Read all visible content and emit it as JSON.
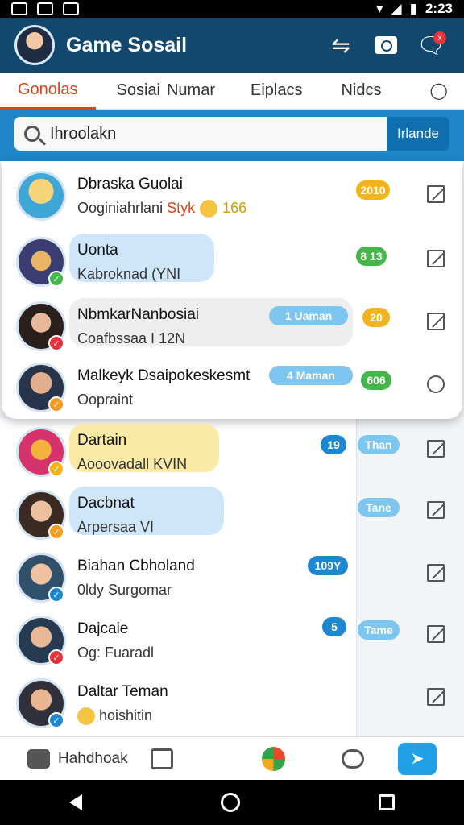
{
  "status": {
    "time": "2:23"
  },
  "app": {
    "title": "Game Sosail"
  },
  "tabs": [
    "Gonolas",
    "Sosiai",
    "Numar",
    "Eiplacs",
    "Nidcs"
  ],
  "search": {
    "value": "Ihroolakn",
    "button": "Irlande"
  },
  "chats": [
    {
      "name": "Dbraska Guolai",
      "sub": "Ooginiahrlani",
      "extra": "Styk",
      "count": "166",
      "badge": "2010",
      "badge_color": "#f2b31d",
      "bubble": false
    },
    {
      "name": "Uonta",
      "sub": "Kabroknad (YNI",
      "badge": "8 13",
      "badge_color": "#45b64a",
      "bubble": true,
      "bubble_color": "#cfe6fa"
    },
    {
      "name": "NbmkarNanbosiai",
      "sub": "Coafbssaa I 12N",
      "badge": "20",
      "badge_color": "#f2b31d",
      "tag": "Uaman",
      "tag_number": "1",
      "bubble": true,
      "bubble_color": "#eeeeee"
    },
    {
      "name": "Malkeyk Dsaipokeskesmt",
      "sub": "Oopraint",
      "badge": "606",
      "badge_color": "#45b64a",
      "tag": "Maman",
      "tag_number": "4",
      "bubble": false
    },
    {
      "name": "Dartain",
      "sub": "Aooovadall KVIN",
      "badge": "19",
      "badge_color": "#1d87cf",
      "side": "Than",
      "bubble": true,
      "bubble_color": "#fbe9a6"
    },
    {
      "name": "Dacbnat",
      "sub": "Arpersaa VI",
      "side": "Tane",
      "bubble": true,
      "bubble_color": "#cfe6fa"
    },
    {
      "name": "Biahan Cbholand",
      "sub": "0ldy Surgomar",
      "badge": "109Y",
      "badge_color": "#1d87cf",
      "bubble": false
    },
    {
      "name": "Dajcaie",
      "sub": "Og: Fuaradl",
      "badge": "5",
      "badge_color": "#1d87cf",
      "side": "Tame",
      "bubble": false
    },
    {
      "name": "Daltar Teman",
      "sub": "hoishitin",
      "bubble": false
    }
  ],
  "bottom_nav": {
    "label": "Hahdhoak"
  }
}
